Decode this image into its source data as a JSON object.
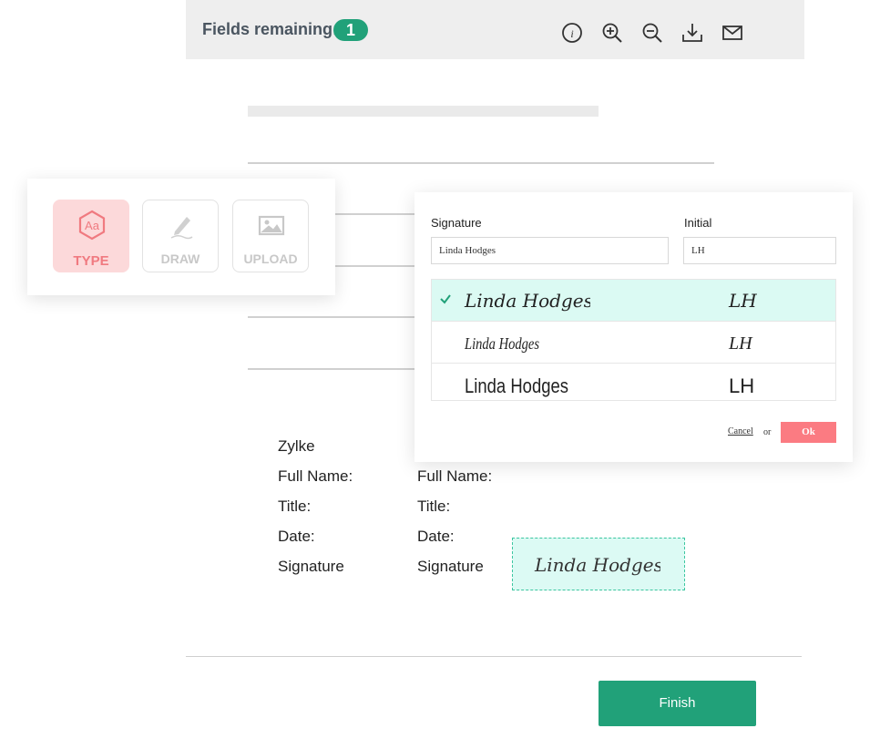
{
  "toolbar": {
    "fields_remaining_label": "Fields remaining:",
    "fields_remaining_count": "1",
    "icons": [
      "info-icon",
      "zoom-in-icon",
      "zoom-out-icon",
      "download-icon",
      "mail-icon"
    ]
  },
  "signature_methods": {
    "type_label": "TYPE",
    "draw_label": "DRAW",
    "upload_label": "UPLOAD",
    "active": "TYPE"
  },
  "signature_dialog": {
    "signature_label": "Signature",
    "initial_label": "Initial",
    "signature_value": "Linda Hodges",
    "initial_value": "LH",
    "options": [
      {
        "signature": "Linda Hodges",
        "initial": "LH",
        "selected": true
      },
      {
        "signature": "Linda Hodges",
        "initial": "LH",
        "selected": false
      },
      {
        "signature": "Linda Hodges",
        "initial": "LH",
        "selected": false
      }
    ],
    "cancel_label": "Cancel",
    "or_label": "or",
    "ok_label": "Ok"
  },
  "signature_block": {
    "left": {
      "company": "Zylke",
      "full_name_label": "Full Name:",
      "title_label": "Title:",
      "date_label": "Date:",
      "signature_label": "Signature"
    },
    "right": {
      "full_name_label": "Full Name:",
      "title_label": "Title:",
      "date_label": "Date:",
      "signature_label": "Signature"
    },
    "signed_value": "Linda Hodges"
  },
  "footer": {
    "finish_label": "Finish"
  },
  "colors": {
    "accent_green": "#21a179",
    "toolbar_bg": "#eeeeee",
    "selected_row": "#dbfaf3",
    "ok_pink": "#fb7b82",
    "type_active_bg": "#fcd9da"
  }
}
